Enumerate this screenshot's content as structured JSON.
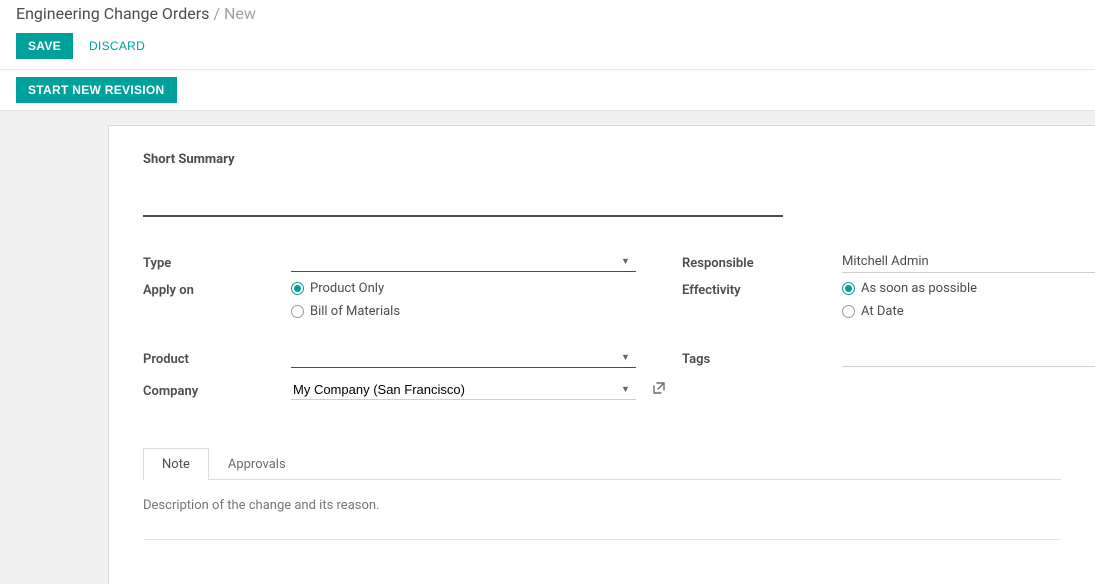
{
  "breadcrumb": {
    "root": "Engineering Change Orders",
    "sep": "/",
    "current": "New"
  },
  "actions": {
    "save": "SAVE",
    "discard": "DISCARD",
    "start_new_revision": "START NEW REVISION"
  },
  "form": {
    "short_summary_label": "Short Summary",
    "short_summary_value": "",
    "left": {
      "type_label": "Type",
      "type_value": "",
      "apply_on_label": "Apply on",
      "apply_on_options": {
        "product_only": "Product Only",
        "bom": "Bill of Materials"
      },
      "apply_on_selected": "product_only",
      "product_label": "Product",
      "product_value": "",
      "company_label": "Company",
      "company_value": "My Company (San Francisco)"
    },
    "right": {
      "responsible_label": "Responsible",
      "responsible_value": "Mitchell Admin",
      "effectivity_label": "Effectivity",
      "effectivity_options": {
        "asap": "As soon as possible",
        "at_date": "At Date"
      },
      "effectivity_selected": "asap",
      "tags_label": "Tags",
      "tags_value": ""
    }
  },
  "tabs": {
    "note": "Note",
    "approvals": "Approvals",
    "active": "note"
  },
  "note_placeholder": "Description of the change and its reason."
}
